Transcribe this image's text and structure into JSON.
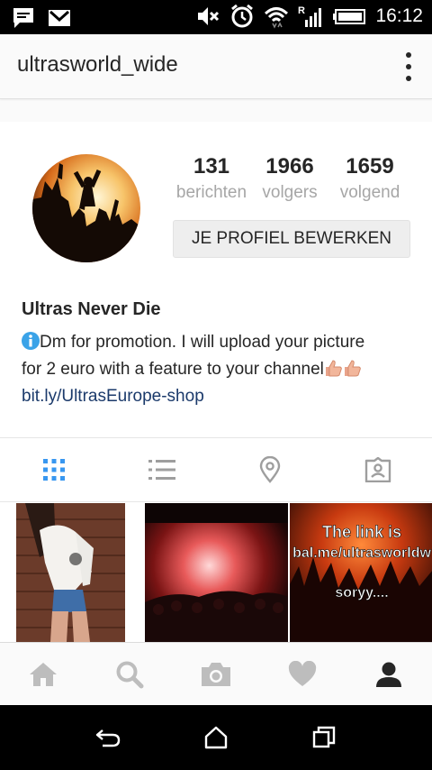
{
  "status_bar": {
    "time": "16:12",
    "icons": [
      "message-icon",
      "gmail-icon",
      "mute-icon",
      "alarm-icon",
      "wifi-icon",
      "signal-icon",
      "battery-icon"
    ]
  },
  "app_bar": {
    "username": "ultrasworld_wide",
    "menu_icon": "more-vert-icon"
  },
  "profile": {
    "stats": [
      {
        "value": "131",
        "label": "berichten"
      },
      {
        "value": "1966",
        "label": "volgers"
      },
      {
        "value": "1659",
        "label": "volgend"
      }
    ],
    "edit_button": "JE PROFIEL BEWERKEN",
    "name": "Ultras Never Die",
    "bio_line1": "Dm for promotion. I will upload your picture",
    "bio_line2": "for 2 euro with a feature to your channel",
    "link": "bit.ly/UltrasEurope-shop"
  },
  "tabs": [
    {
      "icon": "grid-icon",
      "active": true
    },
    {
      "icon": "list-icon",
      "active": false
    },
    {
      "icon": "location-icon",
      "active": false
    },
    {
      "icon": "tagged-icon",
      "active": false
    }
  ],
  "posts": [
    {
      "kind": "photo"
    },
    {
      "kind": "photo"
    },
    {
      "kind": "photo",
      "overlay_line1": "The link is",
      "overlay_line2": "bal.me/ultrasworldw",
      "overlay_line3": "soryy...."
    }
  ],
  "bottom_nav": [
    "home-icon",
    "search-icon",
    "camera-icon",
    "heart-icon",
    "profile-icon"
  ],
  "colors": {
    "accent_blue": "#3897f0",
    "link_blue": "#1b3a6b",
    "label_gray": "#a6a6a6",
    "icon_gray": "#bdbdbd",
    "text_dark": "#262626"
  }
}
